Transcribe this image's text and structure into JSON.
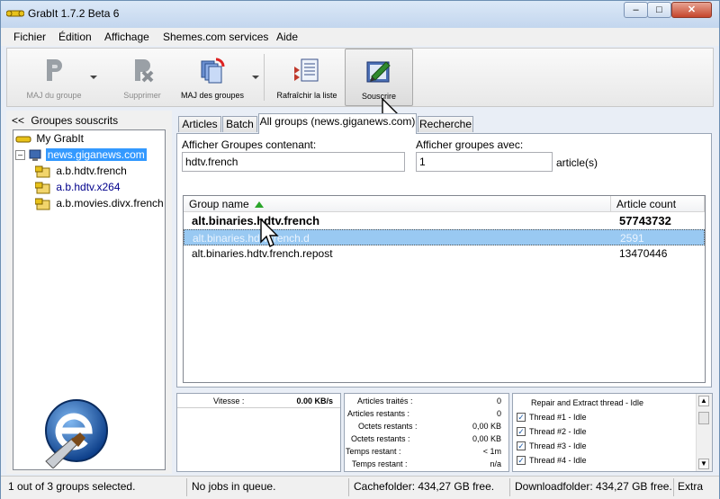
{
  "window": {
    "title": "GrabIt 1.7.2 Beta 6"
  },
  "menu": [
    "Fichier",
    "Édition",
    "Affichage",
    "Shemes.com services",
    "Aide"
  ],
  "toolbar": {
    "maj_groupe": "MAJ du groupe",
    "supprimer": "Supprimer",
    "maj_groupes": "MAJ des groupes",
    "rafraichir": "Rafraîchir la liste",
    "souscrire": "Souscrire"
  },
  "left": {
    "header_arrow": "<<",
    "header": "Groupes souscrits",
    "tree": [
      "My GrabIt",
      "news.giganews.com",
      "a.b.hdtv.french",
      "a.b.hdtv.x264",
      "a.b.movies.divx.french"
    ]
  },
  "tabs": [
    "Articles",
    "Batch",
    "All groups (news.giganews.com)",
    "Recherche"
  ],
  "filter": {
    "contains_label": "Afficher Groupes contenant:",
    "contains_value": "hdtv.french",
    "with_label": "Afficher groupes avec:",
    "with_value": "1",
    "with_unit": "article(s)"
  },
  "groups": {
    "col_name": "Group name",
    "col_count": "Article count",
    "rows": [
      {
        "name": "alt.binaries.hdtv.french",
        "count": "57743732"
      },
      {
        "name": "alt.binaries.hdtv.french.d",
        "count": "2591"
      },
      {
        "name": "alt.binaries.hdtv.french.repost",
        "count": "13470446"
      }
    ]
  },
  "speed": {
    "label": "Vitesse :",
    "value": "0.00 KB/s"
  },
  "stats": [
    {
      "label": "Articles traités :",
      "value": "0"
    },
    {
      "label": "Articles restants :",
      "value": "0"
    },
    {
      "label": "Octets restants :",
      "value": "0,00 KB"
    },
    {
      "label": "Octets restants :",
      "value": "0,00 KB"
    },
    {
      "label": "Temps restant :",
      "value": "< 1m"
    },
    {
      "label": "Temps restant :",
      "value": "n/a"
    }
  ],
  "threads": {
    "title": "Repair and Extract thread - Idle",
    "items": [
      "Thread #1 - Idle",
      "Thread #2 - Idle",
      "Thread #3 - Idle",
      "Thread #4 - Idle"
    ]
  },
  "status": {
    "selection": "1 out of 3 groups selected.",
    "jobs": "No jobs in queue.",
    "cache": "Cachefolder: 434,27 GB free.",
    "download": "Downloadfolder: 434,27 GB free.",
    "extra": "Extra"
  },
  "colors": {
    "selection": "#3399ff",
    "highlight_row": "#99c9f2",
    "sort_arrow": "#2aa52a"
  }
}
